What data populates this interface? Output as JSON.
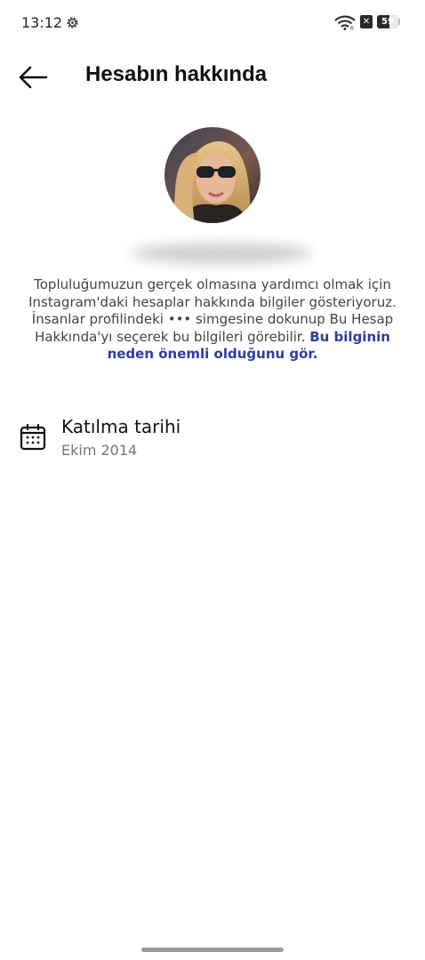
{
  "status_bar": {
    "time": "13:12",
    "battery_level": "59",
    "battery_fraction": 0.59,
    "sim_badge": "✕"
  },
  "header": {
    "title": "Hesabın hakkında",
    "back_icon": "arrow-left-icon"
  },
  "profile": {
    "avatar_icon": "profile-photo"
  },
  "info": {
    "text": "Topluluğumuzun gerçek olmasına yardımcı olmak için Instagram'daki hesaplar hakkında bilgiler gösteriyoruz. İnsanlar profilindeki ••• simgesine dokunup Bu Hesap Hakkında'yı seçerek bu bilgileri görebilir. ",
    "link": "Bu bilginin neden önemli olduğunu gör."
  },
  "joined": {
    "icon": "calendar-icon",
    "label": "Katılma tarihi",
    "value": "Ekim 2014"
  },
  "colors": {
    "link": "#2c3e9e",
    "text_secondary": "#777777"
  }
}
